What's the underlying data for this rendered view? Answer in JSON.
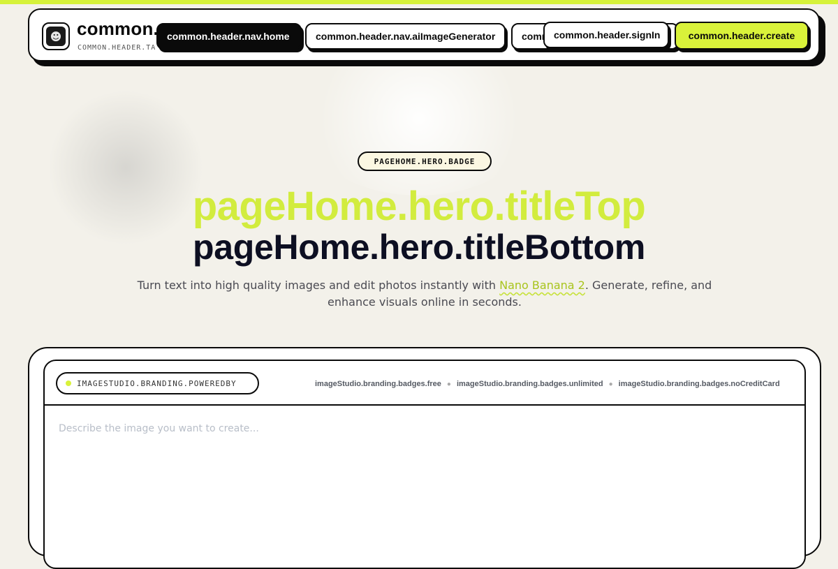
{
  "header": {
    "brand_name": "common.",
    "tagline": "COMMON.HEADER.TA",
    "logo_icon": "face-portrait-icon",
    "nav": {
      "home": "common.header.nav.home",
      "ai_image_generator": "common.header.nav.aiImageGenerator",
      "third_partial": "comm",
      "sign_in": "common.header.signIn",
      "create": "common.header.create"
    }
  },
  "hero": {
    "badge": "PAGEHOME.HERO.BADGE",
    "title_top": "pageHome.hero.titleTop",
    "title_bottom": "pageHome.hero.titleBottom",
    "subtitle_before": "Turn text into high quality images and edit photos instantly with ",
    "subtitle_highlight": "Nano Banana 2",
    "subtitle_after": ". Generate, refine, and enhance visuals online in seconds."
  },
  "studio": {
    "powered_by": "IMAGESTUDIO.BRANDING.POWEREDBY",
    "badges": [
      "imageStudio.branding.badges.free",
      "imageStudio.branding.badges.unlimited",
      "imageStudio.branding.badges.noCreditCard"
    ],
    "prompt_placeholder": "Describe the image you want to create..."
  },
  "colors": {
    "accent": "#d9f23a",
    "title_top": "#d2ec3e",
    "background": "#f3f1ea",
    "ink": "#0a0a0a"
  }
}
